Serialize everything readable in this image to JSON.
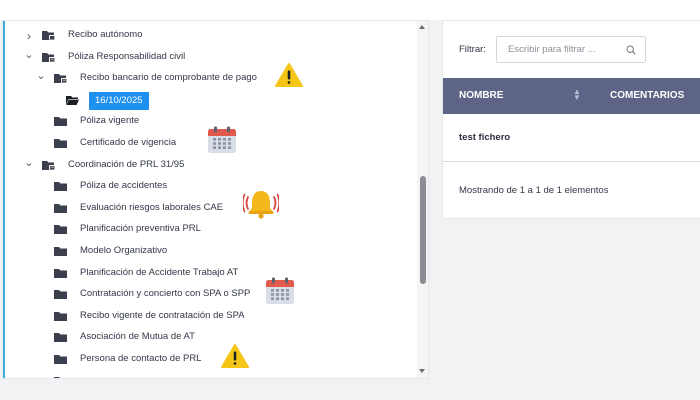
{
  "tree": {
    "items": [
      {
        "label": "Recibo autónomo",
        "level": 0,
        "expander": "collapsed",
        "folder": "closed-doc"
      },
      {
        "label": "Póliza Responsabilidad civil",
        "level": 0,
        "expander": "expanded",
        "folder": "open-doc"
      },
      {
        "label": "Recibo bancario de comprobante de pago",
        "level": 1,
        "expander": "expanded",
        "folder": "open-doc",
        "badge": "warning-icon"
      },
      {
        "label": "16/10/2025",
        "level": 2,
        "expander": "none",
        "folder": "open-dark",
        "selected": true
      },
      {
        "label": "Póliza vigente",
        "level": 1,
        "expander": "none",
        "folder": "closed"
      },
      {
        "label": "Certificado de vigencia",
        "level": 1,
        "expander": "none",
        "folder": "closed",
        "badge": "calendar-icon"
      },
      {
        "label": "Coordinación de PRL 31/95",
        "level": 0,
        "expander": "expanded",
        "folder": "open-doc"
      },
      {
        "label": "Póliza de accidentes",
        "level": 1,
        "expander": "none",
        "folder": "closed"
      },
      {
        "label": "Evaluación riesgos laborales  CAE",
        "level": 1,
        "expander": "none",
        "folder": "closed",
        "badge": "bell-alarm-icon"
      },
      {
        "label": "Planificación preventiva PRL",
        "level": 1,
        "expander": "none",
        "folder": "closed"
      },
      {
        "label": "Modelo Organizativo",
        "level": 1,
        "expander": "none",
        "folder": "closed"
      },
      {
        "label": "Planificación de Accidente Trabajo AT",
        "level": 1,
        "expander": "none",
        "folder": "closed"
      },
      {
        "label": "Contratación y concierto con SPA o SPP",
        "level": 1,
        "expander": "none",
        "folder": "closed",
        "badge": "calendar-icon"
      },
      {
        "label": "Recibo vigente de contratación de SPA",
        "level": 1,
        "expander": "none",
        "folder": "closed"
      },
      {
        "label": "Asociación de Mutua de AT",
        "level": 1,
        "expander": "none",
        "folder": "closed"
      },
      {
        "label": "Persona de contacto de PRL",
        "level": 1,
        "expander": "none",
        "folder": "closed",
        "badge": "warning-icon"
      }
    ]
  },
  "filter": {
    "label": "Filtrar:",
    "placeholder": "Escribir para filtrar ..."
  },
  "table": {
    "columns": [
      "NOMBRE",
      "COMENTARIOS"
    ],
    "rows": [
      {
        "nombre": "test fichero",
        "comentarios": ""
      }
    ],
    "footer": "Mostrando de 1 a 1 de 1 elementos"
  },
  "colors": {
    "accent": "#3ab0d8",
    "selected": "#1e90ef",
    "header": "#5e6486",
    "warning": "#f5c518",
    "calendar_top": "#e05a4e",
    "bell": "#f5b81c",
    "alarm_waves": "#d9443a"
  }
}
